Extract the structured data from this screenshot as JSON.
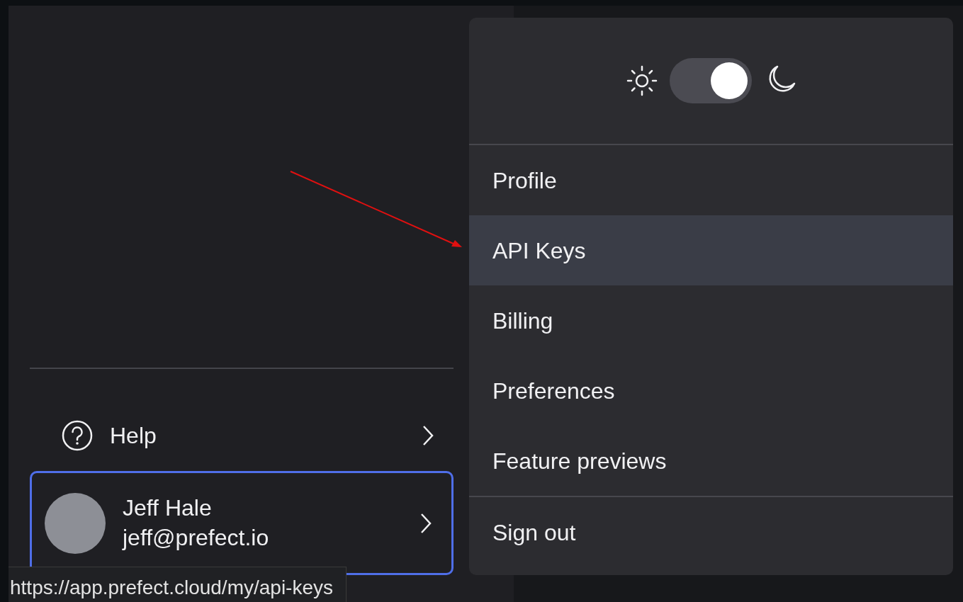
{
  "sidebar": {
    "help": {
      "label": "Help"
    },
    "user": {
      "name": "Jeff Hale",
      "email": "jeff@prefect.io",
      "focused": true
    }
  },
  "user_menu": {
    "theme_toggle": {
      "on": true
    },
    "sections": [
      {
        "items": [
          {
            "label": "Profile",
            "selected": false
          },
          {
            "label": "API Keys",
            "selected": true
          },
          {
            "label": "Billing",
            "selected": false
          },
          {
            "label": "Preferences",
            "selected": false
          },
          {
            "label": "Feature previews",
            "selected": false
          }
        ]
      },
      {
        "items": [
          {
            "label": "Sign out",
            "selected": false
          }
        ]
      }
    ]
  },
  "status_bar": {
    "url": "https://app.prefect.cloud/my/api-keys"
  }
}
